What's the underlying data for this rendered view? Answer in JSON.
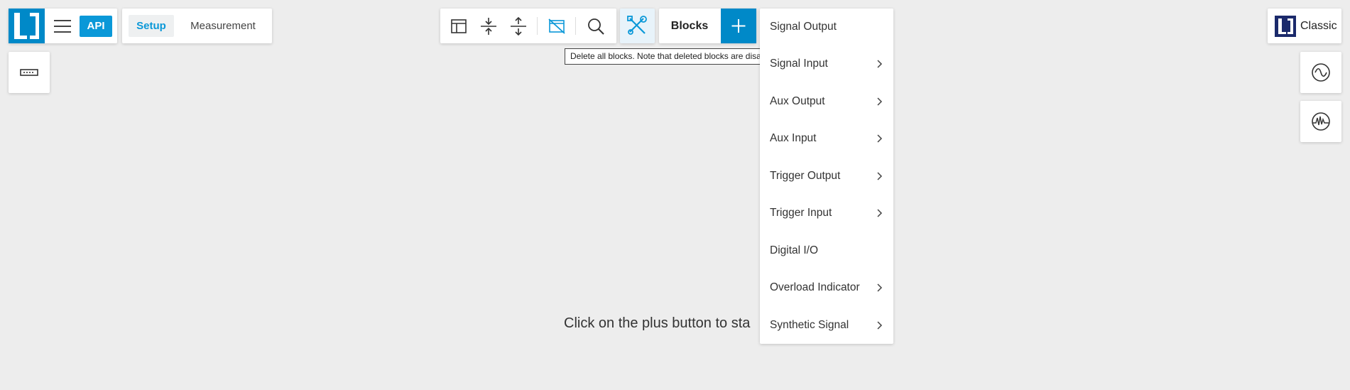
{
  "app": {
    "logo": "lab-one-logo",
    "api_label": "API",
    "menu_icon": "hamburger-icon"
  },
  "mode_tabs": [
    {
      "label": "Setup",
      "active": true
    },
    {
      "label": "Measurement",
      "active": false
    }
  ],
  "toolbar": {
    "icons": [
      "layout-icon",
      "collapse-icon",
      "expand-icon",
      "delete-all-blocks-icon",
      "search-icon",
      "tools-icon"
    ],
    "blocks_label": "Blocks",
    "add_icon": "plus-icon"
  },
  "tooltip": "Delete all blocks. Note that deleted blocks are disabled.",
  "empty_message": "Click on the plus button to sta",
  "add_menu": {
    "items": [
      {
        "label": "Signal Output",
        "has_submenu": false
      },
      {
        "label": "Signal Input",
        "has_submenu": true
      },
      {
        "label": "Aux Output",
        "has_submenu": true
      },
      {
        "label": "Aux Input",
        "has_submenu": true
      },
      {
        "label": "Trigger Output",
        "has_submenu": true
      },
      {
        "label": "Trigger Input",
        "has_submenu": true
      },
      {
        "label": "Digital I/O",
        "has_submenu": false
      },
      {
        "label": "Overload Indicator",
        "has_submenu": true
      },
      {
        "label": "Synthetic Signal",
        "has_submenu": true
      }
    ]
  },
  "right_panel": {
    "classic_label": "Classic",
    "tools": [
      "oscilloscope-icon",
      "spectrum-icon"
    ]
  },
  "left_panel": {
    "tools": [
      "ruler-icon"
    ]
  },
  "colors": {
    "accent": "#0089c8",
    "api_badge": "#0a98d8",
    "background": "#ededed",
    "classic_logo": "#1b2a6b"
  }
}
